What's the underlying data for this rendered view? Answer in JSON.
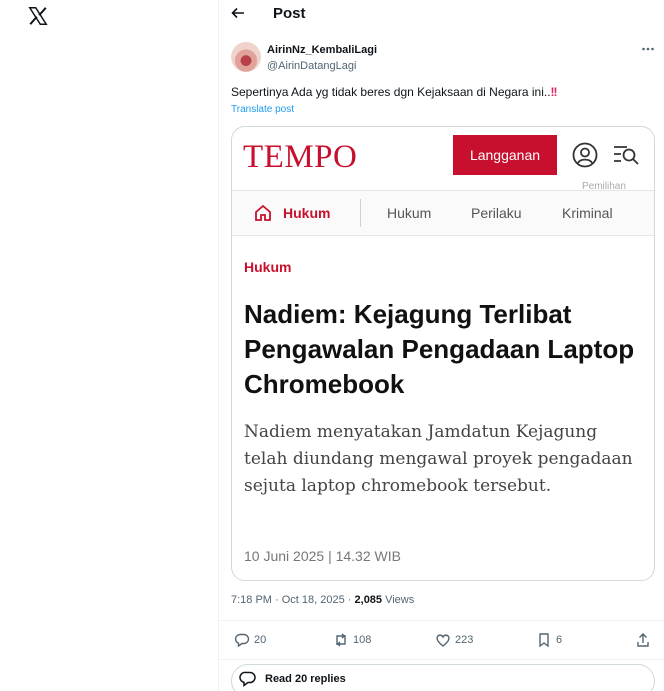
{
  "header": {
    "title": "Post"
  },
  "post": {
    "author_name": "AirinNz_KembaliLagi",
    "author_handle": "@AirinDatangLagi",
    "text": "Sepertinya Ada yg tidak beres dgn Kejaksaan di Negara ini..",
    "emphasis": "!!",
    "translate": "Translate post",
    "time": "7:18 PM · Oct 18, 2025 · ",
    "views_count": "2,085",
    "views_label": " Views"
  },
  "article_card": {
    "logo": "TEMPO",
    "subscribe_label": "Langganan",
    "cut_off_text": "Pemilihan",
    "nav": {
      "active": "Hukum",
      "items": [
        "Hukum",
        "Perilaku",
        "Kriminal"
      ]
    },
    "kicker": "Hukum",
    "headline": "Nadiem: Kejagung Terlibat Pengawalan Pengadaan Laptop Chromebook",
    "lead": "Nadiem menyatakan Jamdatun Kejagung telah diundang mengawal proyek pengadaan sejuta laptop chromebook tersebut.",
    "dateline": "10 Juni 2025 | 14.32 WIB"
  },
  "actions": {
    "replies": "20",
    "reposts": "108",
    "likes": "223",
    "bookmarks": "6"
  },
  "read_replies": "Read 20 replies",
  "colors": {
    "brand_red": "#c8102e",
    "link_blue": "#1d9bf0",
    "muted_gray": "#536471"
  },
  "icons": [
    "x-logo-icon",
    "back-arrow-icon",
    "more-icon",
    "user-icon",
    "menu-search-icon",
    "home-icon",
    "reply-icon",
    "repost-icon",
    "like-icon",
    "bookmark-icon",
    "share-icon"
  ]
}
